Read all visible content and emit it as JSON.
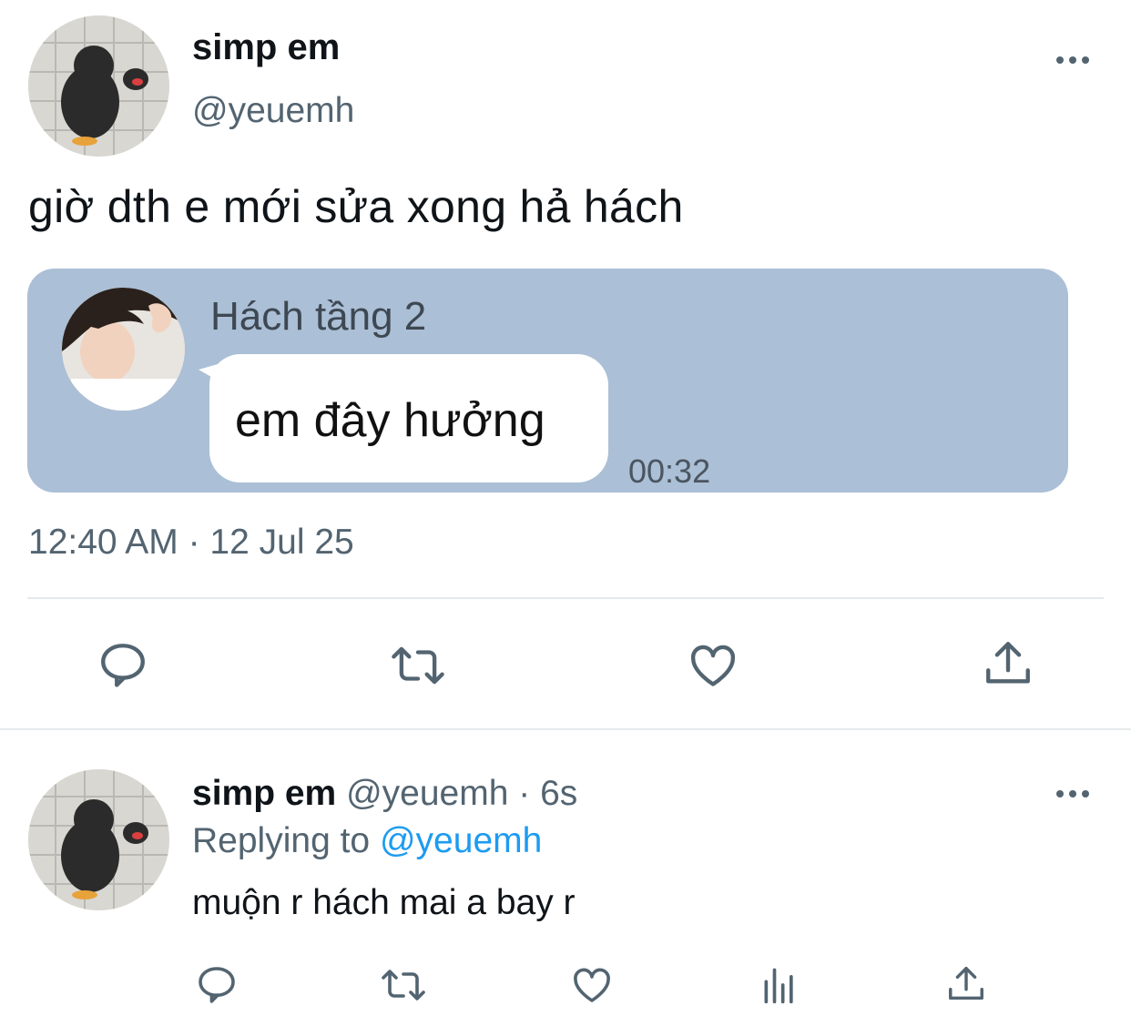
{
  "tweet": {
    "author_name": "simp em",
    "author_handle": "@yeuemh",
    "text": "giờ dth e mới sửa xong hả hách",
    "timestamp": "12:40 AM · 12 Jul 25"
  },
  "embedded_chat": {
    "sender_name": "Hách tầng 2",
    "message": "em đây hưởng",
    "time": "00:32",
    "background": "#abbfd6"
  },
  "actions": [
    "comment-icon",
    "retweet-icon",
    "heart-icon",
    "share-icon"
  ],
  "reply": {
    "author_name": "simp em",
    "meta": "@yeuemh · 6s",
    "replying_prefix": "Replying to",
    "replying_handle": "@yeuemh",
    "text": "muộn r hách mai a bay r",
    "actions": [
      "comment-icon",
      "retweet-icon",
      "heart-icon",
      "analytics-icon",
      "share-icon"
    ]
  },
  "colors": {
    "link": "#1d9bf0",
    "muted": "#536471"
  }
}
